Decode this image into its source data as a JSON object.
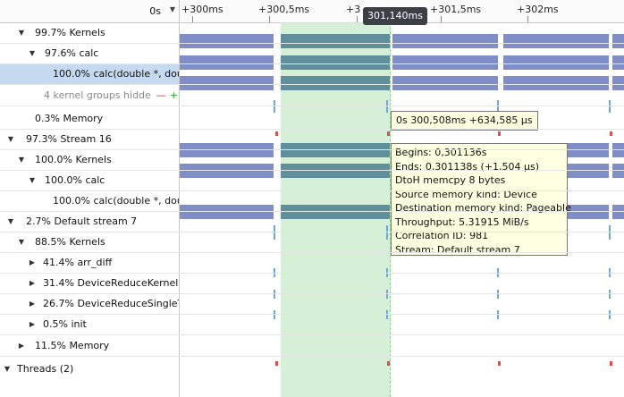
{
  "ruler": {
    "start_label": "0s",
    "ticks": [
      "+300ms",
      "+300,5ms",
      "+3",
      "+301,5ms",
      "+302ms"
    ],
    "cursor_label": "301,140ms"
  },
  "tree": [
    {
      "label": "99.7% Kernels",
      "expanded": true
    },
    {
      "label": "97.6% calc",
      "expanded": true
    },
    {
      "label": "100.0% calc(double *, doub",
      "selected": true
    },
    {
      "label": "4 kernel groups hidde",
      "grey": true
    },
    {
      "label": "0.3% Memory"
    },
    {
      "label": "97.3% Stream 16",
      "expanded": true
    },
    {
      "label": "100.0% Kernels",
      "expanded": true
    },
    {
      "label": "100.0% calc",
      "expanded": true
    },
    {
      "label": "100.0% calc(double *, doub"
    },
    {
      "label": "2.7% Default stream 7",
      "expanded": true
    },
    {
      "label": "88.5% Kernels",
      "expanded": true
    },
    {
      "label": "41.4% arr_diff",
      "expanded": false
    },
    {
      "label": "31.4% DeviceReduceKernel",
      "expanded": false
    },
    {
      "label": "26.7% DeviceReduceSingleTi",
      "expanded": false
    },
    {
      "label": "0.5% init",
      "expanded": false
    },
    {
      "label": "11.5% Memory",
      "expanded": false
    },
    {
      "label": "Threads (2)",
      "expanded": true
    }
  ],
  "hidden_group_controls": {
    "minus": "—",
    "plus": "+"
  },
  "tooltip_small": "0s 300,508ms +634,585 µs",
  "tooltip_detail": [
    "Begins: 0,301136s",
    "Ends: 0,301138s (+1,504 µs)",
    "DtoH memcpy 8 bytes",
    "Source memory kind: Device",
    "Destination memory kind: Pageable",
    "Throughput: 5.31915 MiB/s",
    "Correlation ID: 981",
    "Stream: Default stream 7"
  ],
  "colors": {
    "kernel_bar": "#7f8ec6",
    "selection": "#cfeed2",
    "selected_row": "#c5d9f0",
    "tooltip_bg": "#ffffe1",
    "memory_mark": "#e04b4b"
  }
}
